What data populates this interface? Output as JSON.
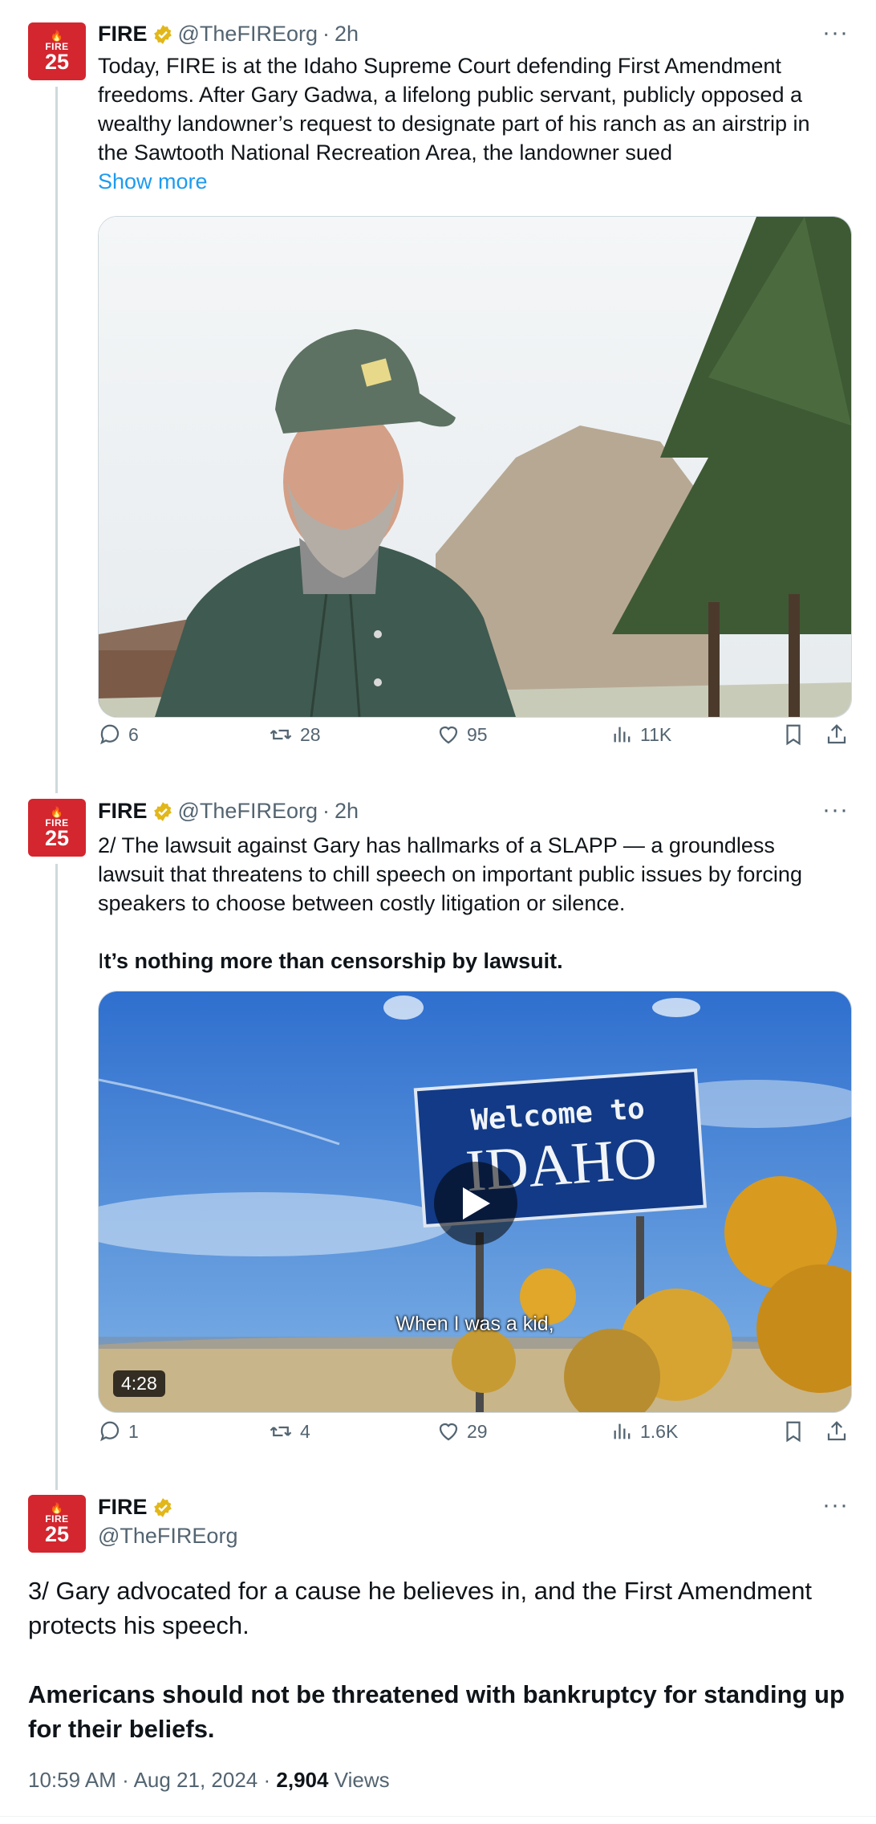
{
  "account": {
    "name": "FIRE",
    "handle": "@TheFIREorg",
    "avatar_word": "FIRE",
    "avatar_number": "25",
    "brand_color": "#d3262f",
    "verified_color": "#e2b719"
  },
  "tweets": [
    {
      "sep": "·",
      "time": "2h",
      "text": "Today, FIRE is at the Idaho Supreme Court defending First Amendment freedoms. After Gary Gadwa, a lifelong public servant, publicly opposed a wealthy landowner’s request to designate part of his ranch as an airstrip in the Sawtooth National Recreation Area, the landowner sued",
      "show_more": "Show more",
      "media_icon": "photo-of-smiling-man",
      "replies": "6",
      "reposts": "28",
      "likes": "95",
      "views": "11K"
    },
    {
      "sep": "·",
      "time": "2h",
      "text": "2/ The lawsuit against Gary has hallmarks of a SLAPP — a groundless lawsuit that threatens to chill speech on important public issues by forcing speakers to choose between costly litigation or silence.",
      "text_prefix": "I",
      "text_bold": "t’s nothing more than censorship by lawsuit.",
      "sign_line1": "Welcome to",
      "sign_line2": "IDAHO",
      "caption": "When I was a kid,",
      "duration": "4:28",
      "replies": "1",
      "reposts": "4",
      "likes": "29",
      "views": "1.6K"
    }
  ],
  "main_tweet": {
    "text": "3/ Gary advocated for a cause he believes in, and the First Amendment protects his speech.",
    "text_bold": "Americans should not be threatened with bankruptcy for standing up for their beliefs.",
    "time": "10:59 AM",
    "sep1": "·",
    "date": "Aug 21, 2024",
    "sep2": "·",
    "views_count": "2,904",
    "views_label": "Views"
  },
  "more_label": "···"
}
